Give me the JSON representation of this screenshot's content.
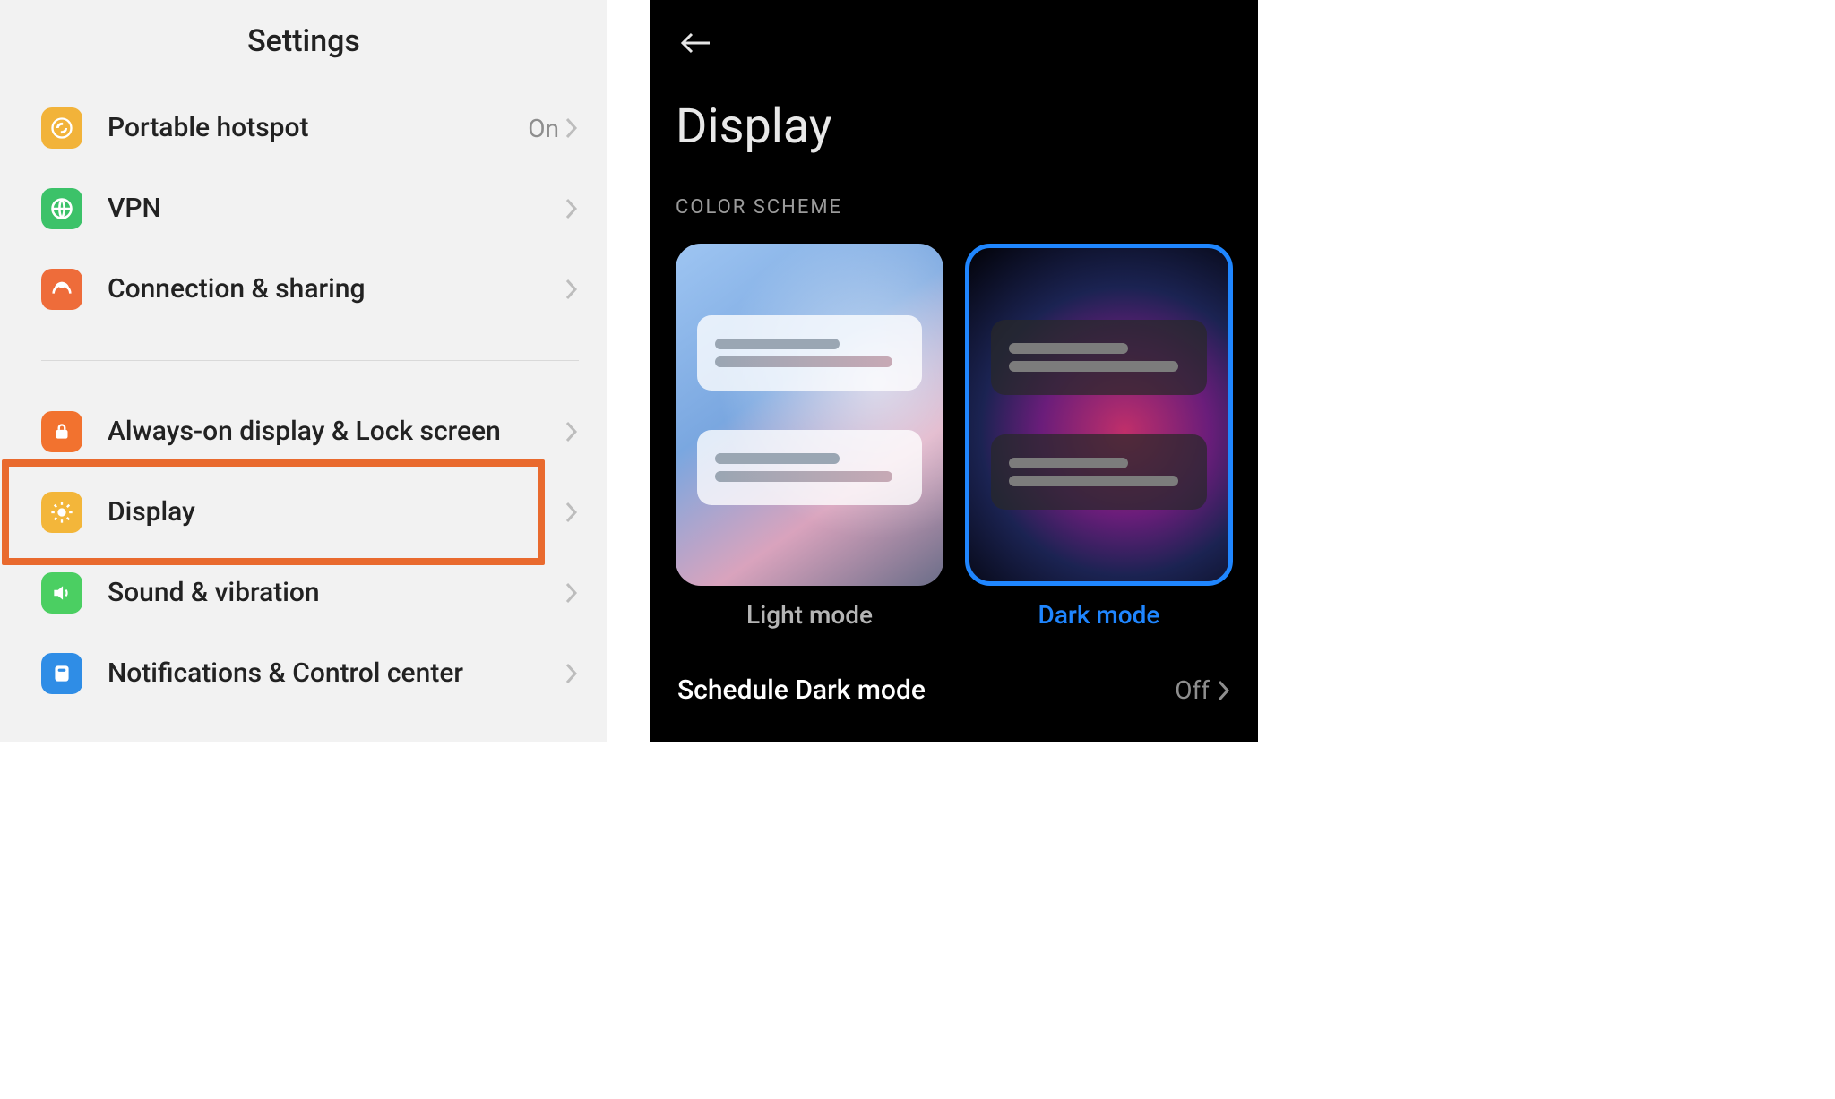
{
  "left": {
    "title": "Settings",
    "items": [
      {
        "key": "hotspot",
        "label": "Portable hotspot",
        "status": "On",
        "icon": "link-icon",
        "color": "ic-hotspot"
      },
      {
        "key": "vpn",
        "label": "VPN",
        "status": "",
        "icon": "globe-icon",
        "color": "ic-vpn"
      },
      {
        "key": "share",
        "label": "Connection & sharing",
        "status": "",
        "icon": "share-icon",
        "color": "ic-share"
      }
    ],
    "items2": [
      {
        "key": "aod",
        "label": "Always-on display & Lock screen",
        "status": "",
        "icon": "lock-icon",
        "color": "ic-aod"
      },
      {
        "key": "display",
        "label": "Display",
        "status": "",
        "icon": "brightness-icon",
        "color": "ic-display",
        "highlighted": true
      },
      {
        "key": "sound",
        "label": "Sound & vibration",
        "status": "",
        "icon": "speaker-icon",
        "color": "ic-sound"
      },
      {
        "key": "notif",
        "label": "Notifications & Control center",
        "status": "",
        "icon": "notifications-icon",
        "color": "ic-notif"
      }
    ]
  },
  "right": {
    "title": "Display",
    "section_label": "COLOR SCHEME",
    "modes": {
      "light_label": "Light mode",
      "dark_label": "Dark mode",
      "selected": "dark"
    },
    "schedule": {
      "label": "Schedule Dark mode",
      "status": "Off"
    }
  }
}
